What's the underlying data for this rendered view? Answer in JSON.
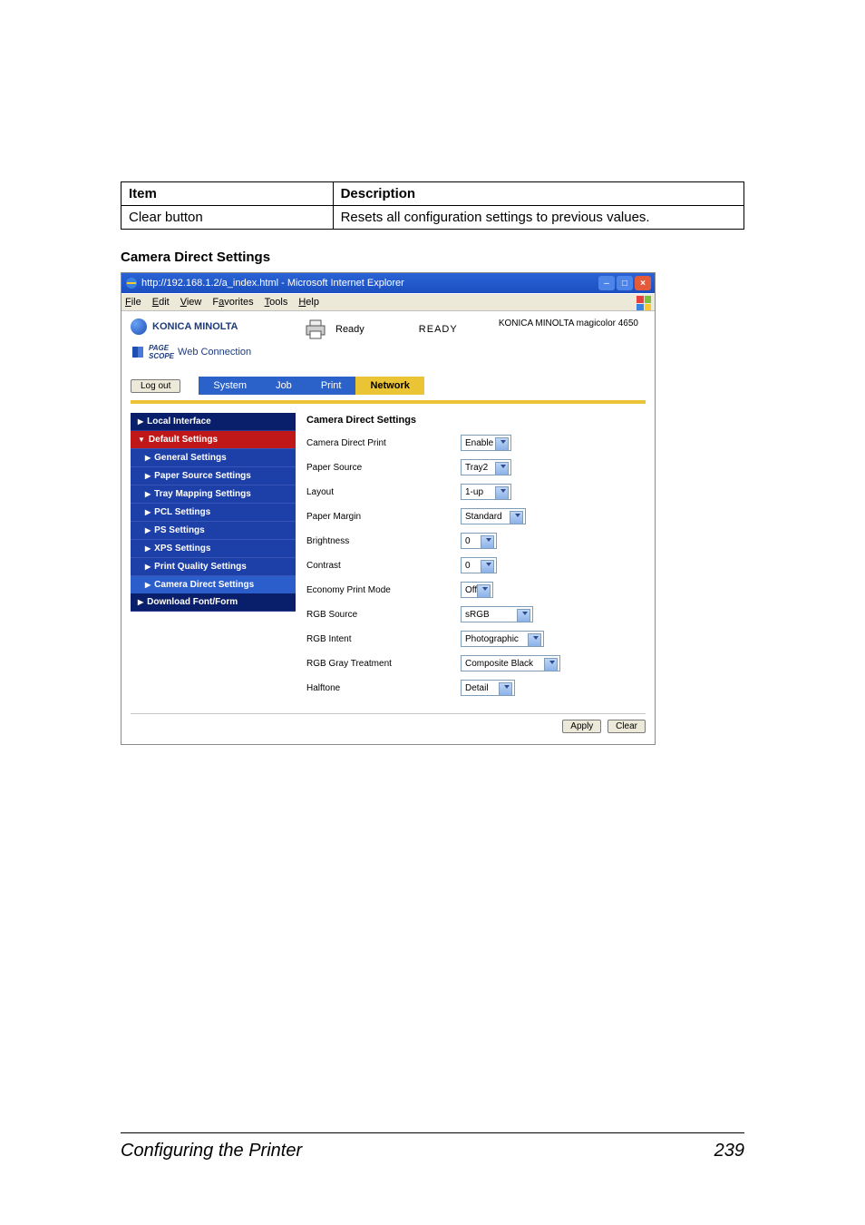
{
  "table": {
    "head_item": "Item",
    "head_desc": "Description",
    "row_item": "Clear button",
    "row_desc": "Resets all configuration settings to previous values."
  },
  "section_heading": "Camera Direct Settings",
  "titlebar": "http://192.168.1.2/a_index.html - Microsoft Internet Explorer",
  "menus": {
    "file": "File",
    "edit": "Edit",
    "view": "View",
    "favorites": "Favorites",
    "tools": "Tools",
    "help": "Help"
  },
  "brand": "KONICA MINOLTA",
  "pagescope": "PageScope Web Connection",
  "status_small": "Ready",
  "status_big": "READY",
  "model": "KONICA MINOLTA magicolor 4650",
  "logout": "Log out",
  "tabs": {
    "system": "System",
    "job": "Job",
    "print": "Print",
    "network": "Network"
  },
  "sidebar": {
    "local": "Local Interface",
    "default": "Default Settings",
    "general": "General Settings",
    "paper": "Paper Source Settings",
    "tray": "Tray Mapping Settings",
    "pcl": "PCL Settings",
    "ps": "PS Settings",
    "xps": "XPS Settings",
    "pq": "Print Quality Settings",
    "camera": "Camera Direct Settings",
    "download": "Download Font/Form"
  },
  "main": {
    "head": "Camera Direct Settings",
    "rows": {
      "cdp": {
        "label": "Camera Direct Print",
        "value": "Enable"
      },
      "ps": {
        "label": "Paper Source",
        "value": "Tray2"
      },
      "layout": {
        "label": "Layout",
        "value": "1-up"
      },
      "margin": {
        "label": "Paper Margin",
        "value": "Standard"
      },
      "bright": {
        "label": "Brightness",
        "value": "0"
      },
      "contrast": {
        "label": "Contrast",
        "value": "0"
      },
      "econ": {
        "label": "Economy Print Mode",
        "value": "Off"
      },
      "rgbsrc": {
        "label": "RGB Source",
        "value": "sRGB"
      },
      "rgbint": {
        "label": "RGB Intent",
        "value": "Photographic"
      },
      "rgbgray": {
        "label": "RGB Gray Treatment",
        "value": "Composite Black"
      },
      "halftone": {
        "label": "Halftone",
        "value": "Detail"
      }
    }
  },
  "buttons": {
    "apply": "Apply",
    "clear": "Clear"
  },
  "footer": {
    "title": "Configuring the Printer",
    "page": "239"
  }
}
